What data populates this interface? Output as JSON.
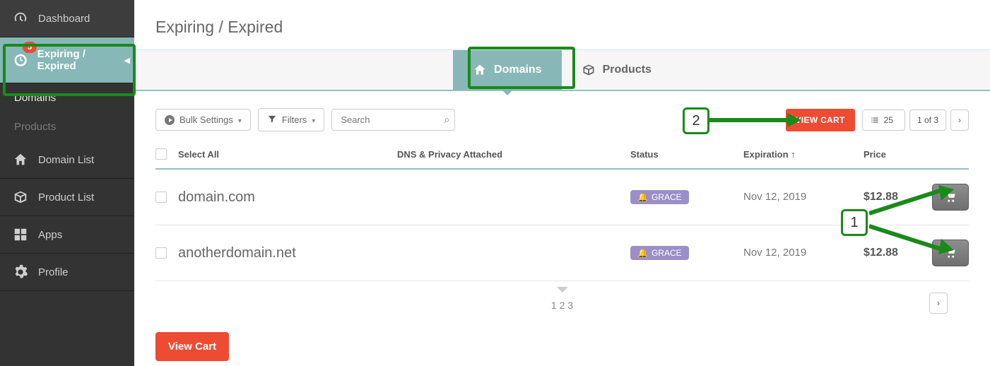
{
  "sidebar": {
    "items": [
      {
        "label": "Dashboard"
      },
      {
        "label": "Expiring / Expired",
        "badge": "5"
      },
      {
        "label": "Domain List"
      },
      {
        "label": "Product List"
      },
      {
        "label": "Apps"
      },
      {
        "label": "Profile"
      }
    ],
    "sub": {
      "domains": "Domains",
      "products": "Products"
    }
  },
  "page": {
    "title": "Expiring / Expired"
  },
  "tabs": {
    "domains": "Domains",
    "products": "Products"
  },
  "toolbar": {
    "bulk": "Bulk Settings",
    "filters": "Filters",
    "search_placeholder": "Search",
    "view_cart": "VIEW CART",
    "per_page": "25",
    "page_position": "1 of 3"
  },
  "table": {
    "headers": {
      "select_all": "Select All",
      "dns": "DNS & Privacy Attached",
      "status": "Status",
      "expiration": "Expiration ↑",
      "price": "Price"
    },
    "rows": [
      {
        "name": "domain.com",
        "status": "GRACE",
        "expiration": "Nov 12, 2019",
        "price": "$12.88"
      },
      {
        "name": "anotherdomain.net",
        "status": "GRACE",
        "expiration": "Nov 12, 2019",
        "price": "$12.88"
      }
    ],
    "pages": "1 2 3"
  },
  "bottom": {
    "view_cart": "View Cart"
  },
  "annotations": {
    "n1": "1",
    "n2": "2"
  }
}
